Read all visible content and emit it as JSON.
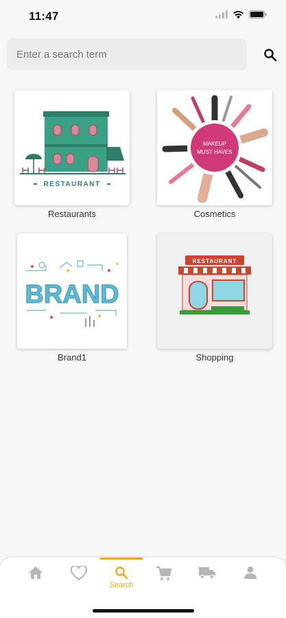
{
  "status_bar": {
    "time": "11:47"
  },
  "search": {
    "placeholder": "Enter a search term",
    "value": ""
  },
  "categories": [
    {
      "label": "Restaurants",
      "image": "restaurant-illustration",
      "image_text": "RESTAURANT"
    },
    {
      "label": "Cosmetics",
      "image": "cosmetics-illustration",
      "image_text": "MAKEUP MUST HAVES"
    },
    {
      "label": "Brand1",
      "image": "brand-illustration",
      "image_text": "BRAND"
    },
    {
      "label": "Shopping",
      "image": "storefront-illustration",
      "image_text": "RESTAURANT"
    }
  ],
  "tab_bar": {
    "tabs": [
      {
        "icon": "home-icon",
        "label": ""
      },
      {
        "icon": "heart-icon",
        "label": ""
      },
      {
        "icon": "search-icon",
        "label": "Search",
        "active": true
      },
      {
        "icon": "cart-icon",
        "label": ""
      },
      {
        "icon": "truck-icon",
        "label": ""
      },
      {
        "icon": "person-icon",
        "label": ""
      }
    ]
  },
  "colors": {
    "accent": "#f5a623",
    "inactive_icon": "#b5b5b5",
    "background": "#f7f7f7"
  }
}
